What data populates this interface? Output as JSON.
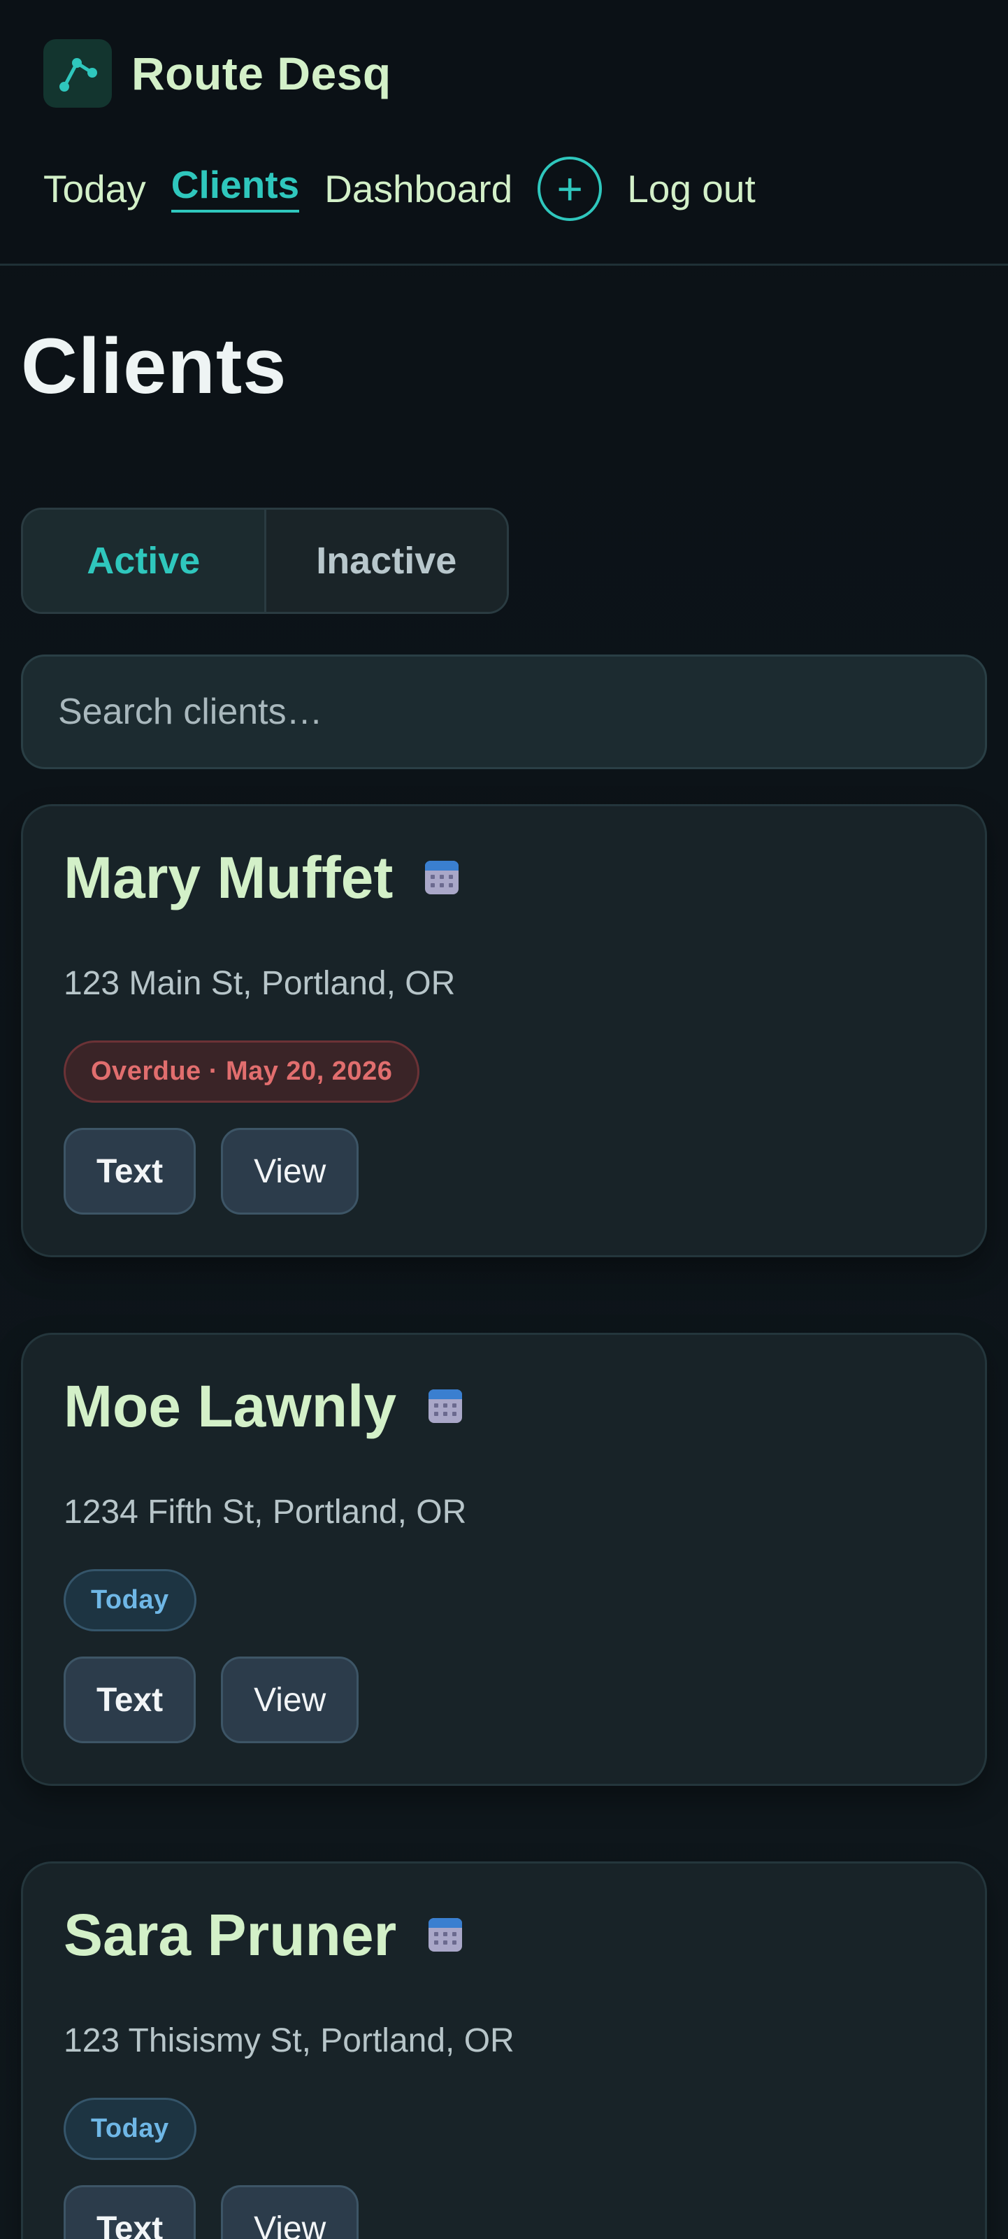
{
  "brand": {
    "name": "Route Desq"
  },
  "nav": {
    "today": "Today",
    "clients": "Clients",
    "dashboard": "Dashboard",
    "add": "+",
    "logout": "Log out"
  },
  "main": {
    "title": "Clients",
    "segments": [
      "Active",
      "Inactive"
    ],
    "search_placeholder": "Search clients…"
  },
  "clients": [
    {
      "name": "Mary Muffet",
      "address": "123 Main St, Portland, OR",
      "status": "Overdue · May 20, 2026",
      "status_kind": "overdue",
      "text_label": "Text",
      "view_label": "View"
    },
    {
      "name": "Moe Lawnly",
      "address": "1234 Fifth St, Portland, OR",
      "status": "Today",
      "status_kind": "today",
      "text_label": "Text",
      "view_label": "View"
    },
    {
      "name": "Sara Pruner",
      "address": "123 Thisismy St, Portland, OR",
      "status": "Today",
      "status_kind": "today",
      "text_label": "Text",
      "view_label": "View"
    }
  ],
  "colors": {
    "accent": "#2fc7bd",
    "brand_text": "#d3f0c8",
    "overdue": "#e16e6e",
    "today": "#6fb7e6"
  }
}
